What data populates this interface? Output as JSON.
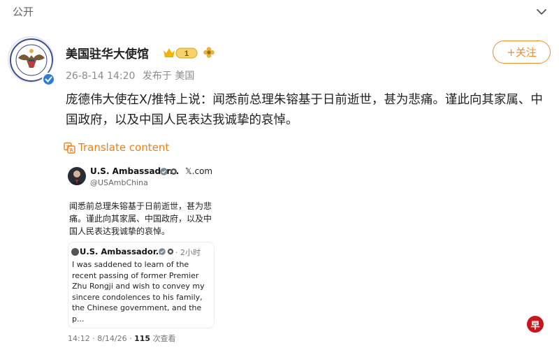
{
  "topbar": {
    "label": "公开"
  },
  "account": {
    "name": "美国驻华大使馆",
    "badge_level": "1",
    "time": "26-8-14 14:20",
    "source": "发布于 美国"
  },
  "follow": {
    "label": "+关注"
  },
  "post": {
    "text": "庞德伟大使在X/推特上说：闻悉前总理朱镕基于日前逝世，甚为悲痛。谨此向其家属、中国政府，以及中国人民表达我诚挚的哀悼。"
  },
  "translate": {
    "label": "Translate content"
  },
  "embed": {
    "name": "U.S. Ambassador...",
    "site": "𝕏.com",
    "handle": "@USAmbChina",
    "text": "闻悉前总理朱镕基于日前逝世，甚为悲痛。谨此向其家属、中国政府，以及中国人民表达我诚挚的哀悼。",
    "quote": {
      "name": "U.S. Ambassador...",
      "time": "· 2小时",
      "text": "I was saddened to learn of the recent passing of former Premier Zhu Rongji and wish to convey my sincere condolences to his family, the Chinese government, and the p..."
    },
    "footer": {
      "datetime": "14:12 · 8/14/26 ·",
      "views": "115",
      "views_label": "次查看"
    }
  },
  "watermark": {
    "text": "早"
  },
  "colors": {
    "accent": "#f28c28",
    "verified": "#2f7cd6",
    "watermark": "#c8161d"
  }
}
